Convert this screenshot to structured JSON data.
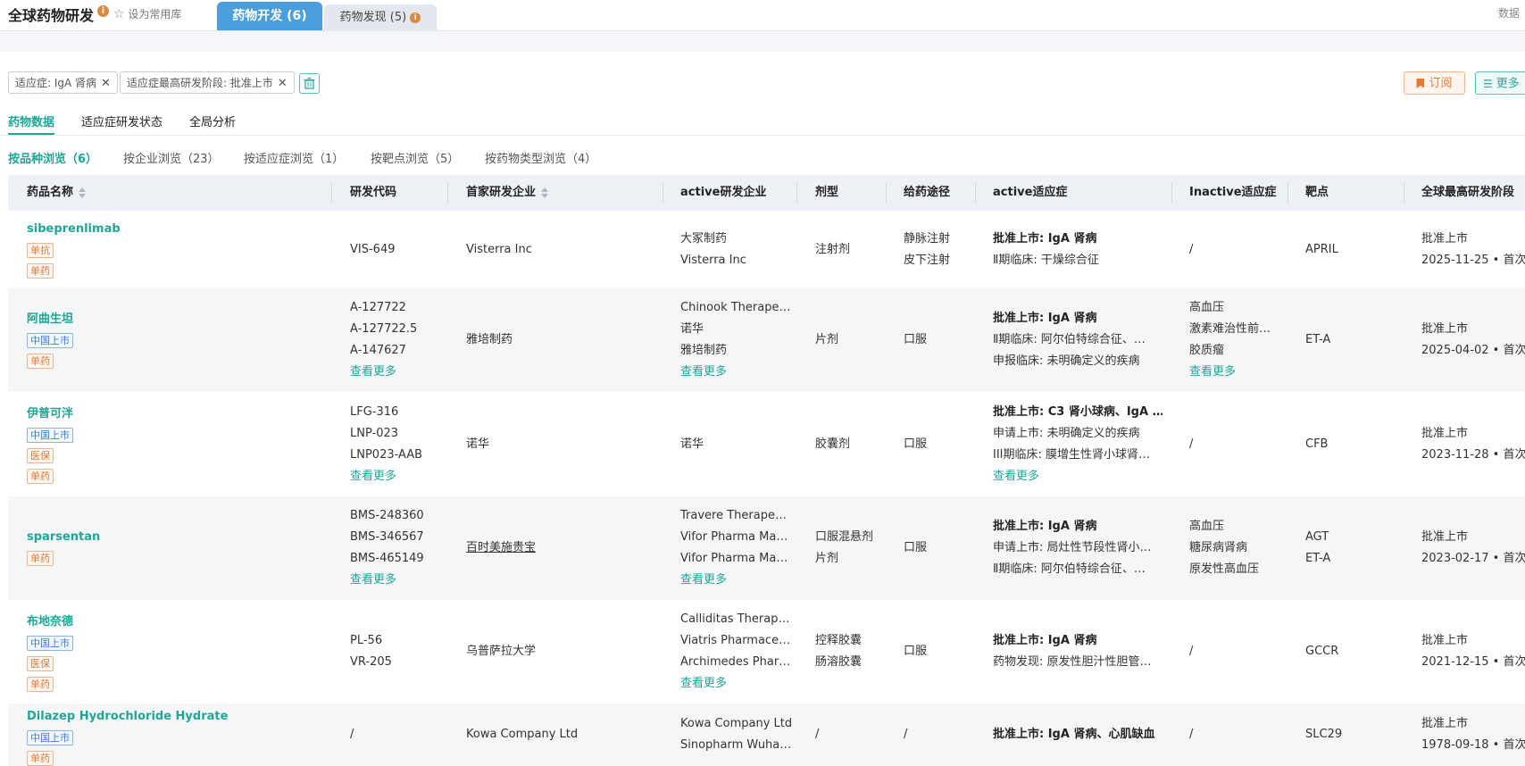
{
  "header": {
    "title": "全球药物研发",
    "favorite_label": "设为常用库",
    "tab_dev": "药物开发 (6)",
    "tab_discovery": "药物发现 (5)",
    "top_right": "数据"
  },
  "filters": {
    "chip1": "适应症: IgA 肾病",
    "chip2": "适应症最高研发阶段: 批准上市",
    "subscribe": "订阅",
    "more": "更多"
  },
  "subtabs": [
    "药物数据",
    "适应症研发状态",
    "全局分析"
  ],
  "browse": [
    "按品种浏览（6）",
    "按企业浏览（23）",
    "按适应症浏览（1）",
    "按靶点浏览（5）",
    "按药物类型浏览（4）"
  ],
  "columns": [
    "药品名称",
    "研发代码",
    "首家研发企业",
    "active研发企业",
    "剂型",
    "给药途径",
    "active适应症",
    "Inactive适应症",
    "靶点",
    "全球最高研发阶段"
  ],
  "rows": [
    {
      "name": "sibeprenlimab",
      "tags": [
        {
          "text": "单抗",
          "color": "orange"
        },
        {
          "text": "单药",
          "color": "orange"
        }
      ],
      "codes": [
        "VIS-649"
      ],
      "first_company": "Visterra Inc",
      "active_companies": [
        "大冢制药",
        "Visterra Inc"
      ],
      "forms": [
        "注射剂"
      ],
      "routes": [
        "静脉注射",
        "皮下注射"
      ],
      "active_ind": [
        "批准上市: IgA 肾病",
        "Ⅱ期临床: 干燥综合征"
      ],
      "inactive_ind": [
        "/"
      ],
      "targets": [
        "APRIL"
      ],
      "stage": [
        "批准上市",
        "2025-11-25 • 首次"
      ]
    },
    {
      "name": "阿曲生坦",
      "tags": [
        {
          "text": "中国上市",
          "color": "blue"
        },
        {
          "text": "单药",
          "color": "orange"
        }
      ],
      "codes": [
        "A-127722",
        "A-127722.5",
        "A-147627"
      ],
      "codes_more": "查看更多",
      "first_company": "雅培制药",
      "active_companies": [
        "Chinook Therape…",
        "诺华",
        "雅培制药"
      ],
      "companies_more": "查看更多",
      "forms": [
        "片剂"
      ],
      "routes": [
        "口服"
      ],
      "active_ind": [
        "批准上市: IgA 肾病",
        "Ⅱ期临床: 阿尔伯特综合征、…",
        "申报临床: 未明确定义的疾病"
      ],
      "inactive_ind": [
        "高血压",
        "激素难治性前…",
        "胶质瘤"
      ],
      "inactive_more": "查看更多",
      "targets": [
        "ET-A"
      ],
      "stage": [
        "批准上市",
        "2025-04-02 • 首次"
      ]
    },
    {
      "name": "伊普可泮",
      "tags": [
        {
          "text": "中国上市",
          "color": "blue"
        },
        {
          "text": "医保",
          "color": "orange"
        },
        {
          "text": "单药",
          "color": "orange"
        }
      ],
      "codes": [
        "LFG-316",
        "LNP-023",
        "LNP023-AAB"
      ],
      "codes_more": "查看更多",
      "first_company": "诺华",
      "active_companies": [
        "诺华"
      ],
      "forms": [
        "胶囊剂"
      ],
      "routes": [
        "口服"
      ],
      "active_ind": [
        "批准上市: C3 肾小球病、IgA …",
        "申请上市: 未明确定义的疾病",
        "III期临床: 膜增生性肾小球肾…"
      ],
      "active_more": "查看更多",
      "inactive_ind": [
        "/"
      ],
      "targets": [
        "CFB"
      ],
      "stage": [
        "批准上市",
        "2023-11-28 • 首次"
      ]
    },
    {
      "name": "sparsentan",
      "tags": [
        {
          "text": "单药",
          "color": "orange"
        }
      ],
      "codes": [
        "BMS-248360",
        "BMS-346567",
        "BMS-465149"
      ],
      "codes_more": "查看更多",
      "first_company": "百时美施贵宝",
      "active_companies": [
        "Travere Therape…",
        "Vifor Pharma Ma…",
        "Vifor Pharma Ma…"
      ],
      "companies_more": "查看更多",
      "forms": [
        "口服混悬剂",
        "片剂"
      ],
      "routes": [
        "口服"
      ],
      "active_ind": [
        "批准上市: IgA 肾病",
        "申请上市: 局灶性节段性肾小…",
        "Ⅱ期临床: 阿尔伯特综合征、…"
      ],
      "inactive_ind": [
        "高血压",
        "糖尿病肾病",
        "原发性高血压"
      ],
      "targets": [
        "AGT",
        "ET-A"
      ],
      "stage": [
        "批准上市",
        "2023-02-17 • 首次"
      ]
    },
    {
      "name": "布地奈德",
      "tags": [
        {
          "text": "中国上市",
          "color": "blue"
        },
        {
          "text": "医保",
          "color": "orange"
        },
        {
          "text": "单药",
          "color": "orange"
        }
      ],
      "codes": [
        "PL-56",
        "VR-205"
      ],
      "first_company": "乌普萨拉大学",
      "active_companies": [
        "Calliditas Therap…",
        "Viatris Pharmace…",
        "Archimedes Phar…"
      ],
      "companies_more": "查看更多",
      "forms": [
        "控释胶囊",
        "肠溶胶囊"
      ],
      "routes": [
        "口服"
      ],
      "active_ind": [
        "批准上市: IgA 肾病",
        "药物发现: 原发性胆汁性胆管…"
      ],
      "inactive_ind": [
        "/"
      ],
      "targets": [
        "GCCR"
      ],
      "stage": [
        "批准上市",
        "2021-12-15 • 首次"
      ]
    },
    {
      "name": "Dilazep Hydrochloride Hydrate",
      "tags": [
        {
          "text": "中国上市",
          "color": "blue"
        },
        {
          "text": "单药",
          "color": "orange"
        }
      ],
      "codes": [
        "/"
      ],
      "first_company": "Kowa Company Ltd",
      "active_companies": [
        "Kowa Company Ltd",
        "Sinopharm Wuha…"
      ],
      "forms": [
        "/"
      ],
      "routes": [
        "/"
      ],
      "active_ind": [
        "批准上市: IgA 肾病、心肌缺血"
      ],
      "inactive_ind": [
        "/"
      ],
      "targets": [
        "SLC29"
      ],
      "stage": [
        "批准上市",
        "1978-09-18 • 首次"
      ]
    }
  ],
  "colors": {
    "accent": "#1fa697",
    "tab_active": "#4a9edc",
    "orange": "#e07b39",
    "blue": "#3a7bd5"
  },
  "icons": [
    "info-icon",
    "star-icon",
    "close-icon",
    "trash-icon",
    "bookmark-icon",
    "list-icon",
    "sort-icon"
  ]
}
